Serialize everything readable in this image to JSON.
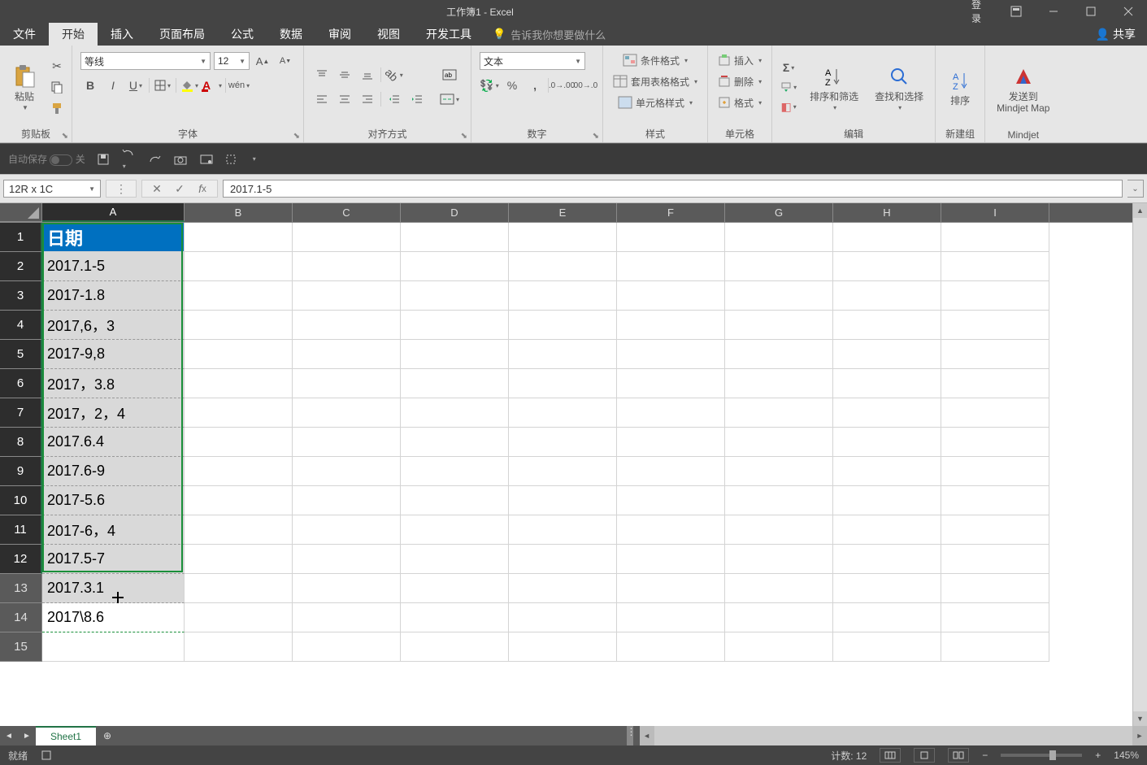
{
  "title": "工作簿1 - Excel",
  "login": "登录",
  "share": "共享",
  "menu": {
    "file": "文件",
    "home": "开始",
    "insert": "插入",
    "layout": "页面布局",
    "formulas": "公式",
    "data": "数据",
    "review": "审阅",
    "view": "视图",
    "dev": "开发工具",
    "hint": "告诉我你想要做什么"
  },
  "ribbon": {
    "clipboard": {
      "label": "剪贴板",
      "paste": "粘贴"
    },
    "font": {
      "label": "字体",
      "name": "等线",
      "size": "12"
    },
    "align": {
      "label": "对齐方式"
    },
    "number": {
      "label": "数字",
      "format": "文本"
    },
    "styles": {
      "label": "样式",
      "cond": "条件格式",
      "table": "套用表格格式",
      "cell": "单元格样式"
    },
    "cells": {
      "label": "单元格",
      "insert": "插入",
      "delete": "删除",
      "format": "格式"
    },
    "editing": {
      "label": "编辑",
      "sort": "排序和筛选",
      "find": "查找和选择"
    },
    "newgroup": {
      "label": "新建组",
      "sortasc": "排序"
    },
    "mindjet": {
      "label": "Mindjet",
      "send": "发送到\nMindjet Map"
    }
  },
  "qat": {
    "autosave": "自动保存"
  },
  "namebox": "12R x 1C",
  "formula": "2017.1-5",
  "columns": [
    "A",
    "B",
    "C",
    "D",
    "E",
    "F",
    "G",
    "H",
    "I"
  ],
  "colA_width": 175,
  "other_col_width": 133,
  "cells": {
    "A1": "日期",
    "A2": "2017.1-5",
    "A3": "2017-1.8",
    "A4": "2017,6，3",
    "A5": "2017-9,8",
    "A6": "2017，3.8",
    "A7": "2017，2，4",
    "A8": "2017.6.4",
    "A9": "2017.6-9",
    "A10": "2017-5.6",
    "A11": "2017-6，4",
    "A12": "2017.5-7",
    "A13": "2017.3.1",
    "A14": "2017\\8.6"
  },
  "selection": {
    "startRow": 1,
    "endRow": 12
  },
  "status": {
    "ready": "就绪",
    "count": "计数: 12",
    "zoom": "145%"
  },
  "sheet": "Sheet1"
}
